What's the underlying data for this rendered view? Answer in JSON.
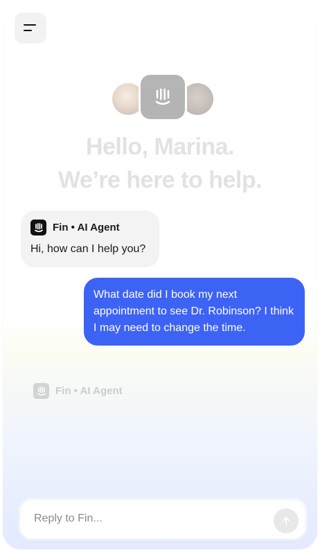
{
  "header": {
    "menu_icon": "menu-icon"
  },
  "welcome": {
    "avatars": [
      "team-member-avatar-1",
      "brand-logo",
      "team-member-avatar-2"
    ],
    "line1": "Hello, Marina.",
    "line2": "We’re here to help."
  },
  "conversation": {
    "agent_message": {
      "name": "Fin • AI Agent",
      "text": "Hi, how can I help you?"
    },
    "user_message": {
      "text": "What date did I book my next appointment to see Dr. Robinson? I think I may need to change the time."
    },
    "typing_indicator": {
      "name": "Fin • AI Agent"
    }
  },
  "composer": {
    "placeholder": "Reply to Fin...",
    "send_icon": "arrow-up-icon"
  },
  "colors": {
    "user_bubble": "#3d63f5",
    "agent_bubble": "#f3f3f3",
    "brand": "#111111"
  }
}
